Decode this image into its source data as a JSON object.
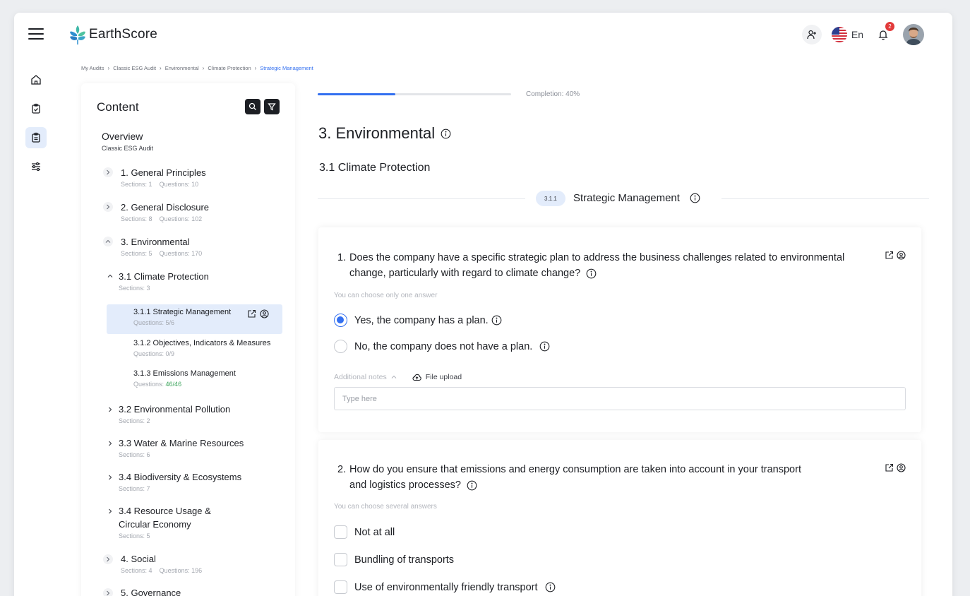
{
  "app": {
    "brand": "EarthScore",
    "language": "En",
    "notifications_count": "2"
  },
  "breadcrumb": [
    "My Audits",
    "Classic ESG Audit",
    "Environmental",
    "Climate Protection",
    "Strategic Management"
  ],
  "sidebar": {
    "title": "Content",
    "overview_title": "Overview",
    "overview_sub": "Classic ESG Audit",
    "sections_word": "Sections:",
    "questions_word": "Questions:",
    "chapters": [
      {
        "title": "1. General Principles",
        "sections": "1",
        "questions": "10"
      },
      {
        "title": "2. General Disclosure",
        "sections": "8",
        "questions": "102"
      },
      {
        "title": "3. Environmental",
        "sections": "5",
        "questions": "170"
      },
      {
        "title": "4. Social",
        "sections": "4",
        "questions": "196"
      },
      {
        "title": "5. Governance"
      }
    ],
    "sub_chapters": [
      {
        "title": "3.1 Climate Protection",
        "sections": "3"
      },
      {
        "title": "3.2 Environmental Pollution",
        "sections": "2"
      },
      {
        "title": "3.3 Water & Marine Resources",
        "sections": "6"
      },
      {
        "title": "3.4 Biodiversity & Ecosystems",
        "sections": "7"
      },
      {
        "title_line1": "3.4 Resource Usage &",
        "title_line2": "Circular Economy",
        "sections": "5"
      }
    ],
    "leaf_items": [
      {
        "title": "3.1.1 Strategic Management",
        "questions": "5/6"
      },
      {
        "title": "3.1.2 Objectives, Indicators & Measures",
        "questions": "0/9"
      },
      {
        "title": "3.1.3 Emissions Management",
        "questions": "46/46"
      }
    ]
  },
  "main": {
    "completion_label": "Completion: 40%",
    "completion_percent": 40,
    "chapter_heading": "3. Environmental",
    "subchapter_heading": "3.1 Climate Protection",
    "section_number": "3.1.1",
    "section_title": "Strategic Management",
    "questions": [
      {
        "number": "1.",
        "text": "Does the company have a specific strategic plan to address the business challenges related to environmental change, particularly with regard to climate change?",
        "hint": "You can choose only one answer",
        "options": [
          "Yes, the company has a plan.",
          "No, the company does not have a plan."
        ],
        "selected": 0,
        "notes_label": "Additional notes",
        "file_label": "File upload",
        "notes_placeholder": "Type here"
      },
      {
        "number": "2.",
        "text": "How do you ensure that emissions and energy consumption are taken into account in your transport and logistics processes?",
        "hint": "You can choose several answers",
        "options": [
          "Not at all",
          "Bundling of transports",
          "Use of environmentally friendly transport"
        ]
      }
    ]
  },
  "colors": {
    "accent": "#3370f0",
    "active_bg": "#e3ecfb",
    "done_green": "#3ca55c",
    "badge_red": "#e23a3a"
  },
  "icons": {
    "menu": "hamburger-icon",
    "home": "home-icon",
    "audit": "clipboard-check-icon",
    "report": "clipboard-list-icon",
    "settings": "sliders-icon",
    "search": "search-icon",
    "filter": "filter-icon",
    "info": "info-icon",
    "edit": "external-edit-icon",
    "assign": "user-circle-icon",
    "upload": "cloud-upload-icon"
  }
}
